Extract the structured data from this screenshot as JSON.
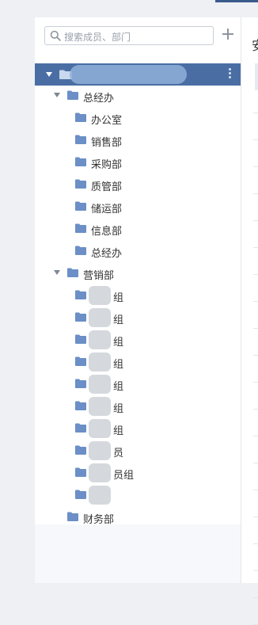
{
  "search": {
    "placeholder": "搜索成员、部门"
  },
  "icons": {
    "search": "search-icon",
    "add": "plus-icon",
    "folder": "folder-icon",
    "more": "more-vertical-icon",
    "expand": "caret-down-icon"
  },
  "colors": {
    "accent": "#4a6ea4",
    "folder": "#6b8fc6",
    "panel": "#ffffff",
    "background": "#eef0f3"
  },
  "right_panel": {
    "header_char": "安"
  },
  "tree": {
    "root": {
      "label": "",
      "expanded": true
    },
    "groups": [
      {
        "label": "总经办",
        "expanded": true,
        "children": [
          {
            "label": "办公室"
          },
          {
            "label": "销售部"
          },
          {
            "label": "采购部"
          },
          {
            "label": "质管部"
          },
          {
            "label": "储运部"
          },
          {
            "label": "信息部"
          },
          {
            "label": "总经办"
          }
        ]
      },
      {
        "label": "营销部",
        "expanded": true,
        "children": [
          {
            "label": "组"
          },
          {
            "label": "组"
          },
          {
            "label": "组"
          },
          {
            "label": "组"
          },
          {
            "label": "组"
          },
          {
            "label": "组"
          },
          {
            "label": "组"
          },
          {
            "label": "员"
          },
          {
            "label": "员组"
          },
          {
            "label": ""
          }
        ]
      },
      {
        "label": "财务部",
        "expanded": false,
        "children": []
      }
    ]
  }
}
